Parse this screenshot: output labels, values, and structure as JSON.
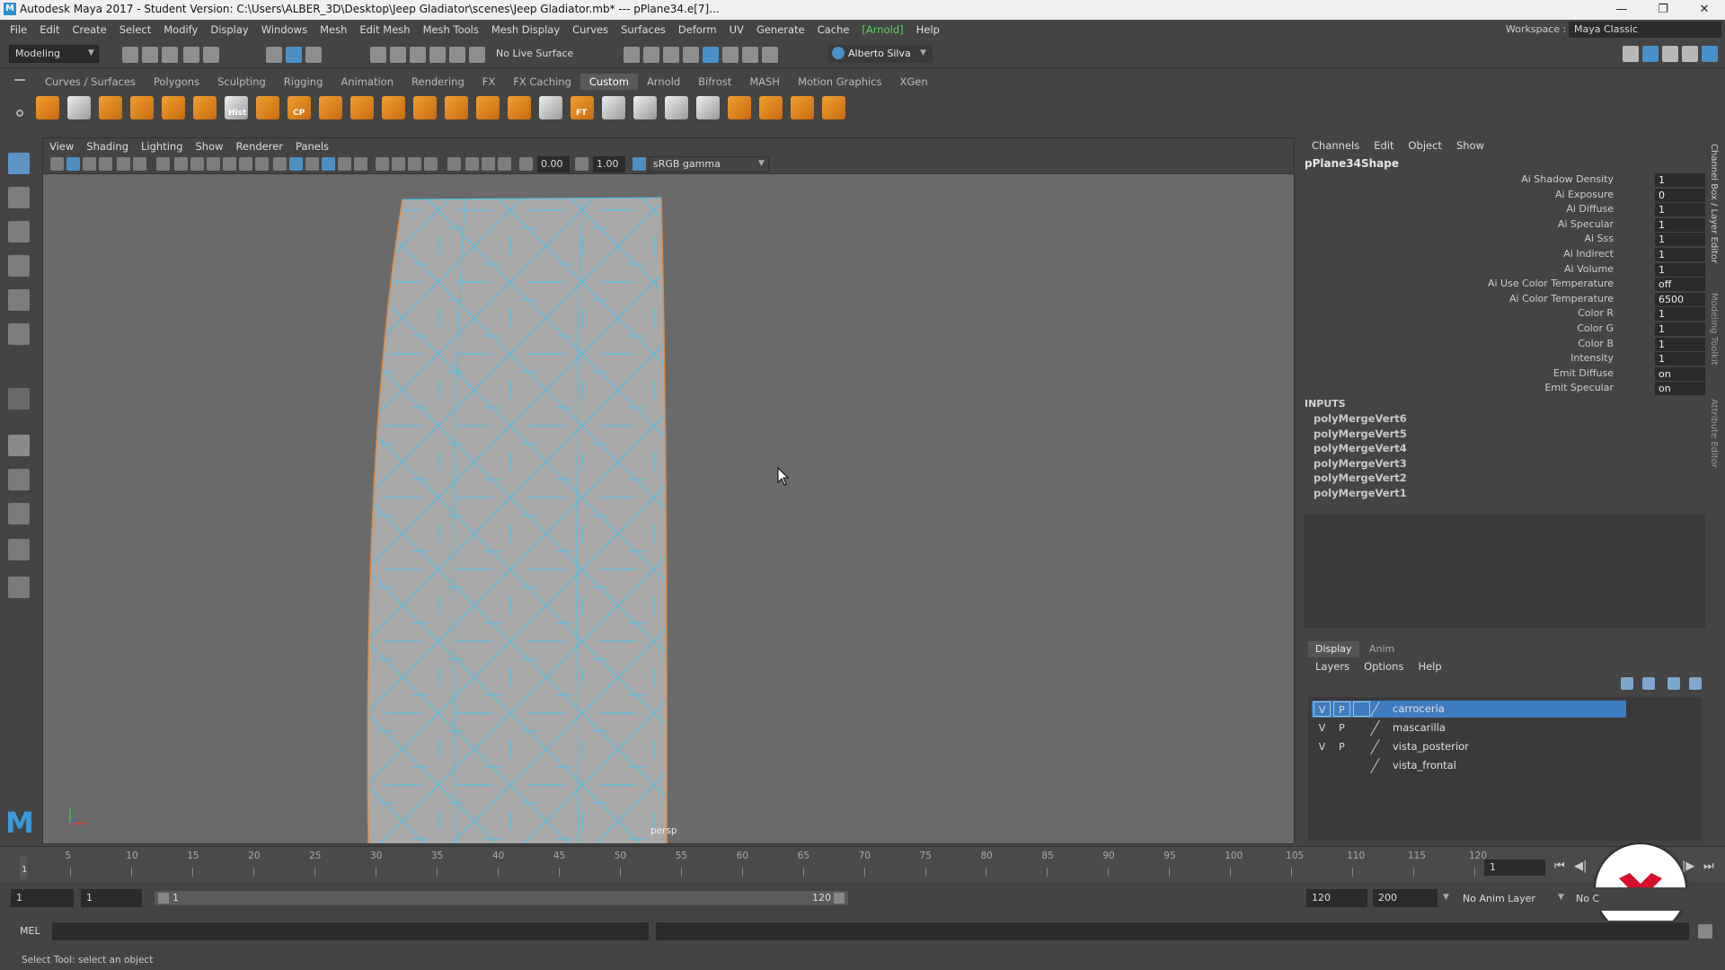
{
  "window": {
    "title": "Autodesk Maya 2017 - Student Version: C:\\Users\\ALBER_3D\\Desktop\\Jeep Gladiator\\scenes\\Jeep Gladiator.mb*  ---  pPlane34.e[7]...",
    "logo": "M"
  },
  "menubar": {
    "items": [
      "File",
      "Edit",
      "Create",
      "Select",
      "Modify",
      "Display",
      "Windows",
      "Mesh",
      "Edit Mesh",
      "Mesh Tools",
      "Mesh Display",
      "Curves",
      "Surfaces",
      "Deform",
      "UV",
      "Generate",
      "Cache",
      "[Arnold]",
      "Help"
    ],
    "workspace_label": "Workspace :",
    "workspace_value": "Maya Classic"
  },
  "statusline": {
    "mode": "Modeling",
    "live_surface": "No Live Surface",
    "user": "Alberto Silva"
  },
  "shelf": {
    "tabs": [
      "Curves / Surfaces",
      "Polygons",
      "Sculpting",
      "Rigging",
      "Animation",
      "Rendering",
      "FX",
      "FX Caching",
      "Custom",
      "Arnold",
      "Bifrost",
      "MASH",
      "Motion Graphics",
      "XGen"
    ],
    "active_tab": "Custom",
    "icon_labels": [
      "Hist",
      "CP",
      "FT"
    ]
  },
  "viewport": {
    "menus": [
      "View",
      "Shading",
      "Lighting",
      "Show",
      "Renderer",
      "Panels"
    ],
    "exposure": "0.00",
    "gamma": "1.00",
    "color_space": "sRGB gamma",
    "camera_label": "persp"
  },
  "channelbox": {
    "menus": [
      "Channels",
      "Edit",
      "Object",
      "Show"
    ],
    "node_name": "pPlane34Shape",
    "attributes": [
      {
        "name": "Ai Shadow Density",
        "value": "1"
      },
      {
        "name": "Ai Exposure",
        "value": "0"
      },
      {
        "name": "Ai Diffuse",
        "value": "1"
      },
      {
        "name": "Ai Specular",
        "value": "1"
      },
      {
        "name": "Ai Sss",
        "value": "1"
      },
      {
        "name": "Ai Indirect",
        "value": "1"
      },
      {
        "name": "Ai Volume",
        "value": "1"
      },
      {
        "name": "Ai Use Color Temperature",
        "value": "off"
      },
      {
        "name": "Ai Color Temperature",
        "value": "6500"
      },
      {
        "name": "Color R",
        "value": "1"
      },
      {
        "name": "Color G",
        "value": "1"
      },
      {
        "name": "Color B",
        "value": "1"
      },
      {
        "name": "Intensity",
        "value": "1"
      },
      {
        "name": "Emit Diffuse",
        "value": "on"
      },
      {
        "name": "Emit Specular",
        "value": "on"
      }
    ],
    "inputs_heading": "INPUTS",
    "inputs": [
      "polyMergeVert6",
      "polyMergeVert5",
      "polyMergeVert4",
      "polyMergeVert3",
      "polyMergeVert2",
      "polyMergeVert1"
    ],
    "side_tabs": [
      "Channel Box / Layer Editor",
      "Modeling Toolkit",
      "Attribute Editor"
    ]
  },
  "layers": {
    "tabs": [
      "Display",
      "Anim"
    ],
    "active_tab": "Display",
    "menus": [
      "Layers",
      "Options",
      "Help"
    ],
    "rows": [
      {
        "v": "V",
        "p": "P",
        "name": "carroceria",
        "selected": true
      },
      {
        "v": "V",
        "p": "P",
        "name": "mascarilla",
        "selected": false
      },
      {
        "v": "V",
        "p": "P",
        "name": "vista_posterior",
        "selected": false
      },
      {
        "v": "",
        "p": "",
        "name": "vista_frontal",
        "selected": false
      }
    ]
  },
  "timeline": {
    "ticks": [
      "5",
      "10",
      "15",
      "20",
      "25",
      "30",
      "35",
      "40",
      "45",
      "50",
      "55",
      "60",
      "65",
      "70",
      "75",
      "80",
      "85",
      "90",
      "95",
      "100",
      "105",
      "110",
      "115",
      "120"
    ],
    "start_marker": "1",
    "current_frame": "1"
  },
  "range": {
    "start": "1",
    "playback_start": "1",
    "slider_start": "1",
    "slider_end": "120",
    "playback_end": "120",
    "end": "200",
    "anim_layer": "No Anim Layer",
    "char_set": "No C"
  },
  "cmdline": {
    "language": "MEL"
  },
  "helpline": {
    "text": "Select Tool: select an object"
  },
  "colors": {
    "accent": "#4a90c8",
    "wireframe": "#3fc4f0",
    "viewport_bg": "#6a6a6a"
  }
}
